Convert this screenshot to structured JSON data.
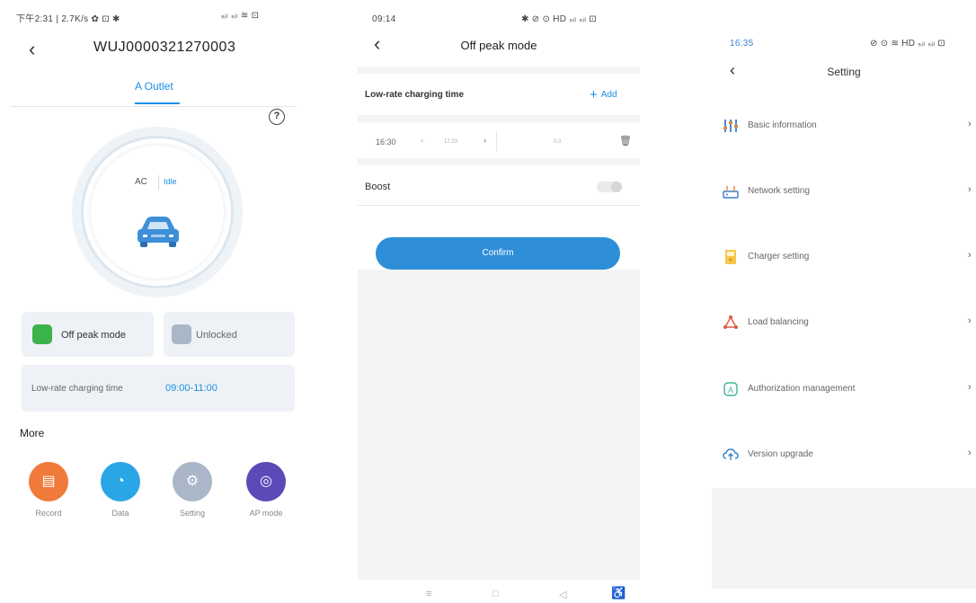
{
  "screen1": {
    "status_bar": "下午2:31 | 2.7K/s ✿ ⊡ ✱",
    "status_right": "ₛᵢₗ ₛᵢₗ ≋ ⊡",
    "title": "WUJ0000321270003",
    "tab": "A Outlet",
    "help_symbol": "?",
    "ac_label": "AC",
    "state": "Idle",
    "off_peak_label": "Off peak mode",
    "unlocked_label": "Unlocked",
    "low_rate_label": "Low-rate charging time",
    "low_rate_value": "09:00-11:00",
    "more_label": "More",
    "more_items": [
      {
        "label": "Record",
        "color": "#f07a3a"
      },
      {
        "label": "Data",
        "color": "#2aa6e6"
      },
      {
        "label": "Setting",
        "color": "#a9b7c8"
      },
      {
        "label": "AP mode",
        "color": "#5a4bb8"
      }
    ],
    "accent": "#1a8fe3",
    "off_peak_icon_color": "#3cb34a"
  },
  "screen2": {
    "status_left": "09:14",
    "status_right": "✱ ⊘ ⊙ HD ₛᵢₗ ₛᵢₗ ⊡",
    "title": "Off peak mode",
    "section_label": "Low-rate charging time",
    "add_label": "Add",
    "time_start": "16:30",
    "time_mid": "17:23",
    "time_end": "0.0",
    "boost_label": "Boost",
    "confirm_label": "Confirm",
    "nav_icons": [
      "≡",
      "□",
      "◁",
      "♿"
    ]
  },
  "screen3": {
    "status_left": "16:35",
    "status_right": "⊘ ⊙ ≋ HD ₛᵢₗ ₛᵢₗ ⊡",
    "title": "Setting",
    "items": [
      {
        "label": "Basic information",
        "icon": "sliders-icon"
      },
      {
        "label": "Network setting",
        "icon": "router-icon"
      },
      {
        "label": "Charger setting",
        "icon": "charger-icon"
      },
      {
        "label": "Load balancing",
        "icon": "triangle-nodes-icon"
      },
      {
        "label": "Authorization management",
        "icon": "shield-a-icon"
      },
      {
        "label": "Version upgrade",
        "icon": "cloud-upload-icon"
      }
    ]
  }
}
